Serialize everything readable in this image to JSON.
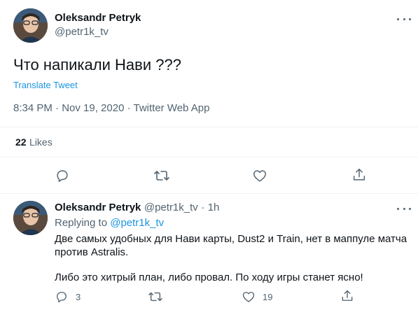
{
  "main_tweet": {
    "author_name": "Oleksandr Petryk",
    "author_handle": "@petr1k_tv",
    "text": "Что напикали Нави ???",
    "translate_label": "Translate Tweet",
    "timestamp": "8:34 PM · Nov 19, 2020 · Twitter Web App",
    "likes_count": "22",
    "likes_label": "Likes"
  },
  "reply": {
    "author_name": "Oleksandr Petryk",
    "author_handle": "@petr1k_tv",
    "separator": "·",
    "time_ago": "1h",
    "replying_to_label": "Replying to",
    "replying_to_handle": "@petr1k_tv",
    "text_line1": "Две самых удобных для Нави карты, Dust2 и Train, нет в маппуле матча",
    "text_line2": "против Astralis.",
    "text_line3": "Либо это хитрый план, либо провал. По ходу игры станет ясно!",
    "reply_count": "3",
    "like_count": "19"
  },
  "colors": {
    "link": "#1b95e0",
    "secondary_text": "#536471",
    "icon": "#536471",
    "divider": "#eff3f4"
  },
  "icons": [
    "more-icon",
    "reply-icon",
    "retweet-icon",
    "like-icon",
    "share-icon"
  ]
}
